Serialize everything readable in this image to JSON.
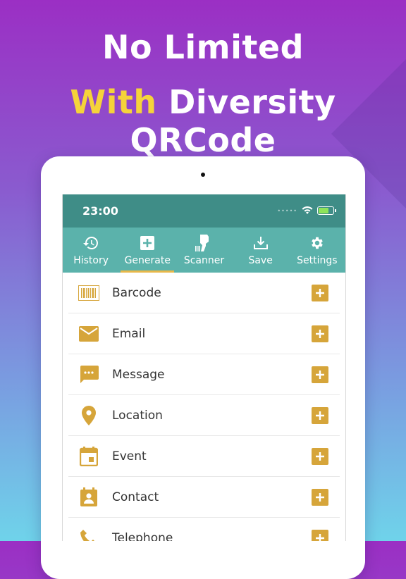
{
  "headline": {
    "line1": "No Limited",
    "line2_highlight": "With",
    "line2_rest": " Diversity QRCode"
  },
  "status_bar": {
    "time": "23:00",
    "dots": "•••••"
  },
  "tabs": [
    {
      "label": "History",
      "icon": "history-icon",
      "active": false
    },
    {
      "label": "Generate",
      "icon": "plus-box-icon",
      "active": true
    },
    {
      "label": "Scanner",
      "icon": "scanner-icon",
      "active": false
    },
    {
      "label": "Save",
      "icon": "download-icon",
      "active": false
    },
    {
      "label": "Settings",
      "icon": "gear-icon",
      "active": false
    }
  ],
  "items": [
    {
      "label": "Barcode",
      "icon": "barcode-icon"
    },
    {
      "label": "Email",
      "icon": "email-icon"
    },
    {
      "label": "Message",
      "icon": "message-icon"
    },
    {
      "label": "Location",
      "icon": "location-pin-icon"
    },
    {
      "label": "Event",
      "icon": "calendar-icon"
    },
    {
      "label": "Contact",
      "icon": "contact-card-icon"
    },
    {
      "label": "Telephone",
      "icon": "phone-icon"
    }
  ],
  "colors": {
    "accent": "#d6a53a",
    "header": "#3f8d87",
    "tabbar": "#5bb2ab",
    "headline_highlight": "#f5d33a"
  }
}
